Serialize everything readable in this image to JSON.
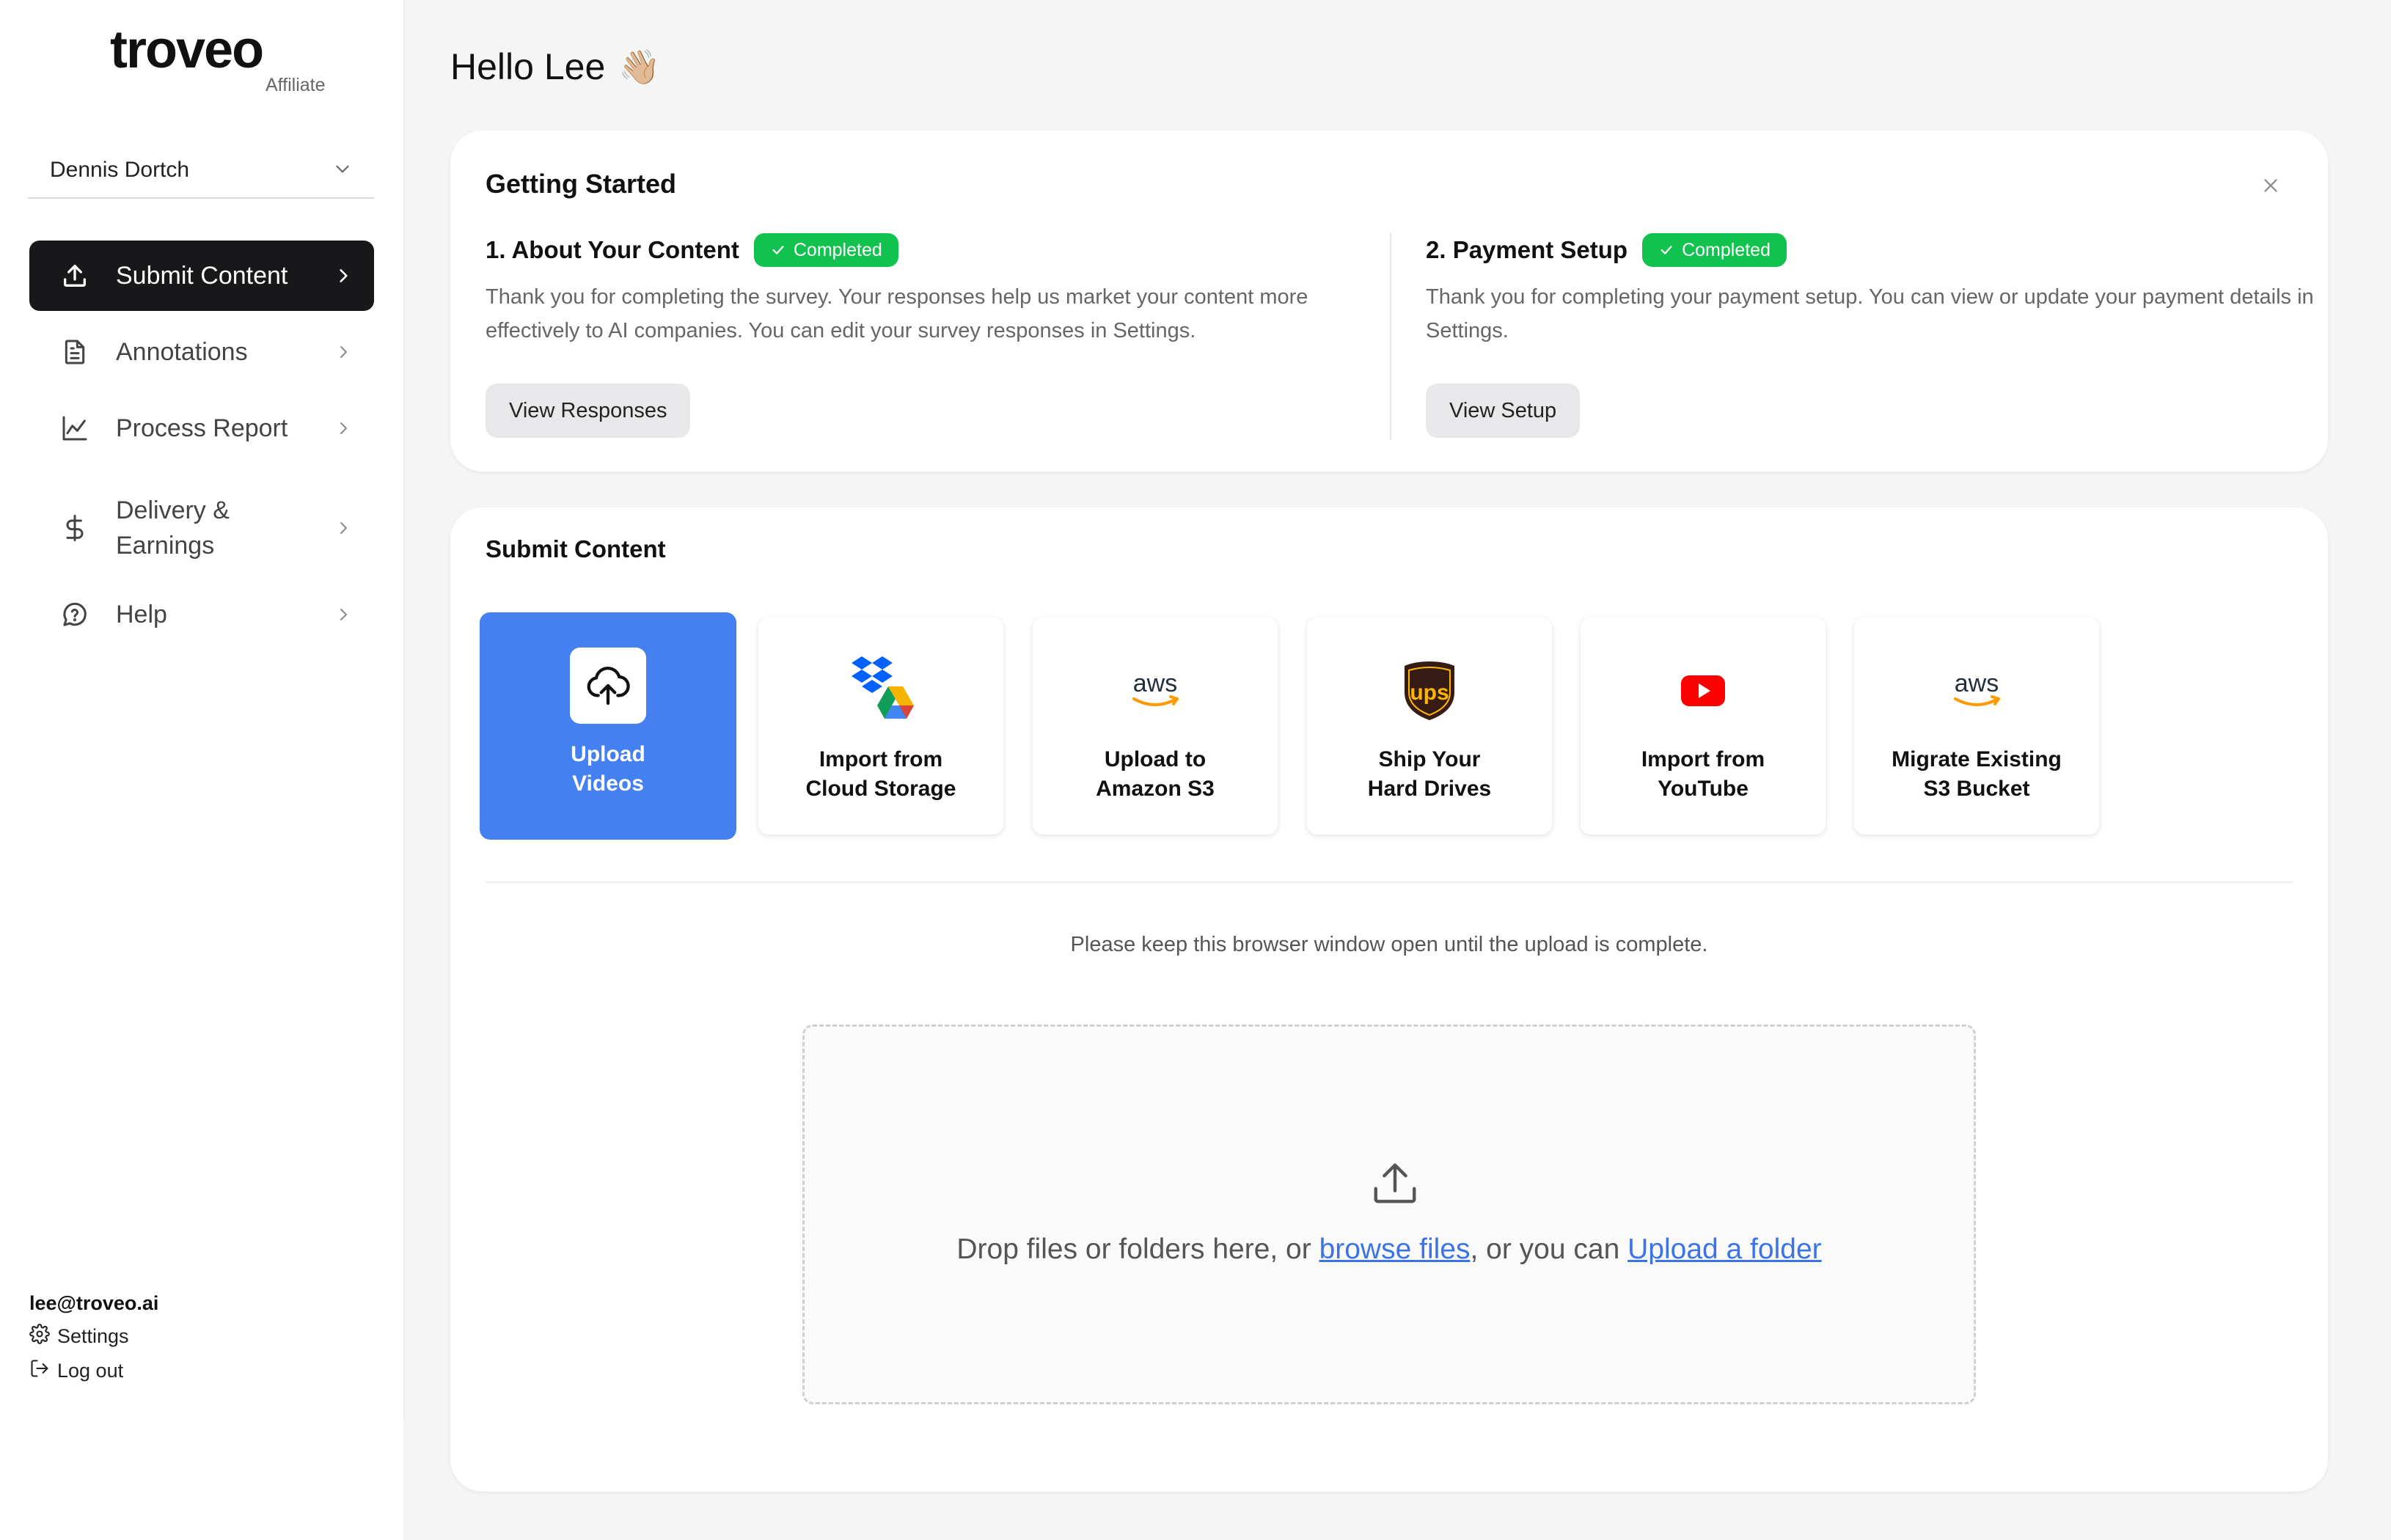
{
  "brand": {
    "logo": "troveo",
    "subtitle": "Affiliate"
  },
  "user_select": {
    "value": "Dennis Dortch"
  },
  "nav": [
    {
      "label": "Submit Content",
      "icon": "upload-icon",
      "active": true
    },
    {
      "label": "Annotations",
      "icon": "document-icon",
      "active": false
    },
    {
      "label": "Process Report",
      "icon": "line-chart-icon",
      "active": false
    },
    {
      "label": "Delivery & Earnings",
      "icon": "dollar-icon",
      "active": false
    },
    {
      "label": "Help",
      "icon": "help-bubble-icon",
      "active": false
    }
  ],
  "account": {
    "email": "lee@troveo.ai",
    "settings": "Settings",
    "logout": "Log out"
  },
  "greeting": {
    "text": "Hello Lee",
    "emoji": "👋🏼"
  },
  "getting_started": {
    "title": "Getting Started",
    "steps": [
      {
        "title": "1. About Your Content",
        "badge": "Completed",
        "description": "Thank you for completing the survey. Your responses help us market your content more effectively to AI companies. You can edit your survey responses in Settings.",
        "button": "View Responses"
      },
      {
        "title": "2. Payment Setup",
        "badge": "Completed",
        "description": "Thank you for completing your payment setup. You can view or update your payment details in Settings.",
        "button": "View Setup"
      }
    ]
  },
  "submit_content": {
    "title": "Submit Content",
    "options": [
      {
        "line1": "Upload",
        "line2": "Videos",
        "icon": "cloud-upload-icon",
        "selected": true
      },
      {
        "line1": "Import from",
        "line2": "Cloud Storage",
        "icon": "dropbox-drive-icon",
        "selected": false
      },
      {
        "line1": "Upload to",
        "line2": "Amazon S3",
        "icon": "aws-icon",
        "selected": false
      },
      {
        "line1": "Ship Your",
        "line2": "Hard Drives",
        "icon": "ups-icon",
        "selected": false
      },
      {
        "line1": "Import from",
        "line2": "YouTube",
        "icon": "youtube-icon",
        "selected": false
      },
      {
        "line1": "Migrate Existing",
        "line2": "S3 Bucket",
        "icon": "aws-icon",
        "selected": false
      }
    ],
    "notice": "Please keep this browser window open until the upload is complete.",
    "dropzone": {
      "prefix": "Drop files or folders here, or ",
      "browse": "browse files",
      "middle": ", or you can ",
      "folder": "Upload a folder"
    }
  },
  "colors": {
    "accent": "#4580f0",
    "success": "#12c24f",
    "link": "#3b74e6",
    "active_nav": "#18181b"
  },
  "icons": {
    "aws_text": "aws",
    "ups_text": "ups"
  }
}
